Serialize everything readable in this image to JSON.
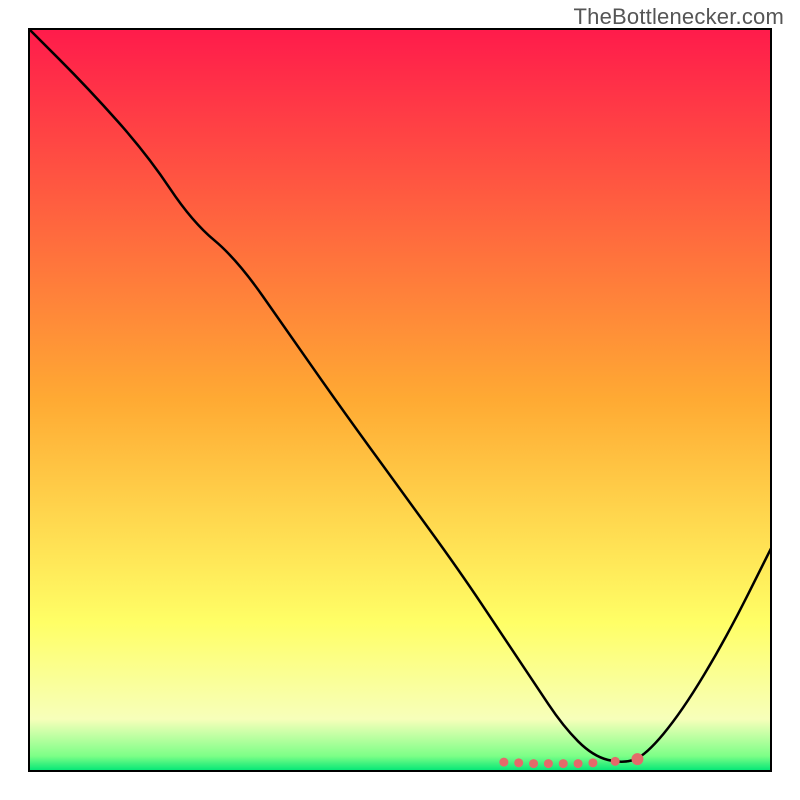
{
  "watermark": "TheBottlenecker.com",
  "chart_data": {
    "type": "line",
    "title": "",
    "xlabel": "",
    "ylabel": "",
    "xlim": [
      0,
      100
    ],
    "ylim": [
      0,
      100
    ],
    "background": {
      "gradient_stops": [
        {
          "offset": 0.0,
          "color": "#ff1b4b"
        },
        {
          "offset": 0.5,
          "color": "#ffaa33"
        },
        {
          "offset": 0.8,
          "color": "#ffff66"
        },
        {
          "offset": 0.93,
          "color": "#f7ffba"
        },
        {
          "offset": 0.98,
          "color": "#7cff87"
        },
        {
          "offset": 1.0,
          "color": "#00e676"
        }
      ]
    },
    "series": [
      {
        "name": "curve",
        "color": "#000000",
        "x": [
          0,
          8,
          16,
          22,
          28,
          35,
          42,
          50,
          58,
          64,
          68,
          72,
          76,
          80,
          83,
          88,
          94,
          100
        ],
        "y": [
          100,
          92,
          83,
          74,
          69,
          59,
          49,
          38,
          27,
          18,
          12,
          6,
          2,
          1,
          2,
          8,
          18,
          30
        ]
      }
    ],
    "markers": {
      "name": "bottom-dots",
      "color": "#e46a6a",
      "points": [
        {
          "x": 64,
          "y": 1.2
        },
        {
          "x": 66,
          "y": 1.1
        },
        {
          "x": 68,
          "y": 1.0
        },
        {
          "x": 70,
          "y": 1.0
        },
        {
          "x": 72,
          "y": 1.0
        },
        {
          "x": 74,
          "y": 1.0
        },
        {
          "x": 76,
          "y": 1.1
        },
        {
          "x": 79,
          "y": 1.3
        },
        {
          "x": 82,
          "y": 1.6
        }
      ]
    },
    "axes": {
      "show_ticks": false,
      "frame_color": "#000000",
      "frame_width": 2
    }
  }
}
